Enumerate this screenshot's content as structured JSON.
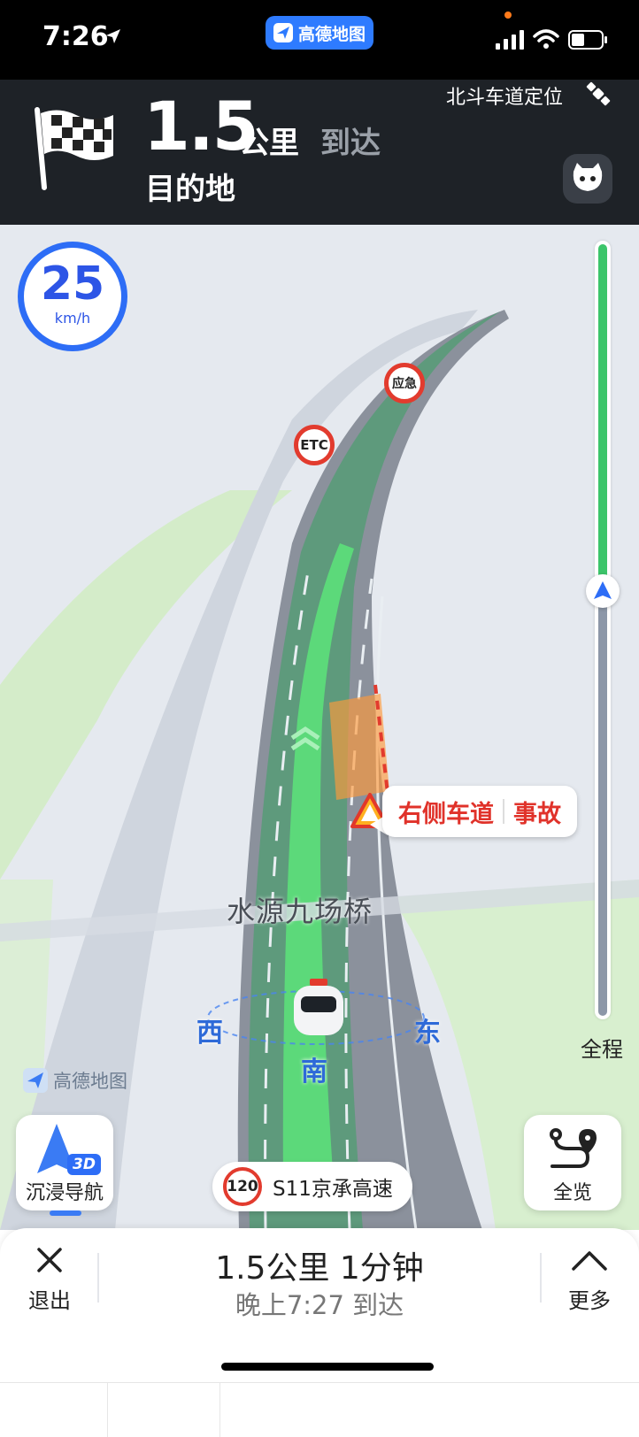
{
  "status_bar": {
    "time": "7:26",
    "app_name": "高德地图"
  },
  "nav_header": {
    "distance_value": "1.5",
    "distance_unit": "公里",
    "arrive_label": "到达",
    "destination": "目的地",
    "beidou_label": "北斗车道定位"
  },
  "map": {
    "speed_value": "25",
    "speed_unit": "km/h",
    "road_signs": [
      "ETC",
      "应急"
    ],
    "incident": {
      "lane": "右侧车道",
      "type": "事故"
    },
    "bridge_name": "水源九场桥",
    "compass": {
      "west": "西",
      "south": "南",
      "east": "东"
    },
    "watermark": "高德地图",
    "route_progress": 0.45,
    "full_route_label": "全程",
    "immersive_nav_label": "沉浸导航",
    "immersive_badge": "3D",
    "overview_label": "全览",
    "road": {
      "speed_limit": "120",
      "name": "S11京承高速"
    }
  },
  "bottom_sheet": {
    "exit_label": "退出",
    "eta_main": "1.5公里 1分钟",
    "eta_sub": "晚上7:27 到达",
    "more_label": "更多"
  },
  "colors": {
    "accent_blue": "#2d6df6",
    "route_green": "#3cc56a",
    "alert_red": "#e0322a"
  }
}
